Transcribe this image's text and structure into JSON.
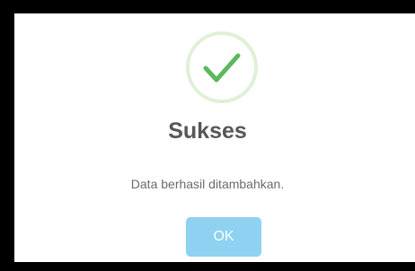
{
  "dialog": {
    "icon": "check-circle-icon",
    "title": "Sukses",
    "message": "Data berhasil ditambahkan.",
    "ok_label": "OK"
  },
  "colors": {
    "success_green": "#5cb85c",
    "success_ring": "#dff0d8",
    "button_bg": "#8ed1f0",
    "title_text": "#575757",
    "backdrop": "#000000"
  }
}
